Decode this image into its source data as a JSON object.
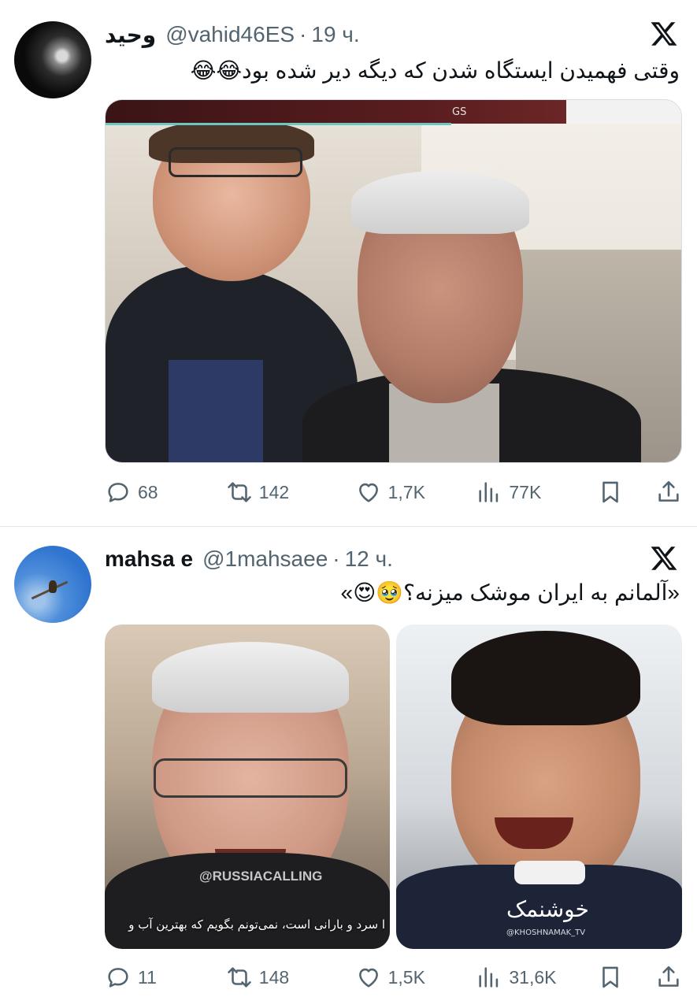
{
  "tweets": [
    {
      "display_name": "وحید",
      "handle": "@vahid46ES",
      "separator": "·",
      "time": "19 ч.",
      "text": "وقتی فهمیدن ایستگاه شدن که دیگه دیر شده بود😂😂",
      "media": [
        {
          "overlay_label": "GS"
        }
      ],
      "stats": {
        "replies": "68",
        "retweets": "142",
        "likes": "1,7K",
        "views": "77K"
      },
      "icons": {
        "reply": "reply-icon",
        "retweet": "retweet-icon",
        "like": "heart-icon",
        "views": "views-icon",
        "bookmark": "bookmark-icon",
        "share": "share-icon",
        "brand": "x-logo-icon"
      }
    },
    {
      "display_name": "mahsa e",
      "handle": "@1mahsaee",
      "separator": "·",
      "time": "12 ч.",
      "text": "«آلمانم به ایران موشک میزنه؟🥹😍»",
      "media": [
        {
          "watermark": "@RUSSIACALLING",
          "subtitle": "ا سرد و بارانی است، نمی‌تونم بگویم که بهترین آب و"
        },
        {
          "logo": "خوشنمک",
          "logo_handle": "@KHOSHNAMAK_TV"
        }
      ],
      "stats": {
        "replies": "11",
        "retweets": "148",
        "likes": "1,5K",
        "views": "31,6K"
      },
      "icons": {
        "reply": "reply-icon",
        "retweet": "retweet-icon",
        "like": "heart-icon",
        "views": "views-icon",
        "bookmark": "bookmark-icon",
        "share": "share-icon",
        "brand": "x-logo-icon"
      }
    }
  ],
  "colors": {
    "text": "#0f1419",
    "secondary": "#536471",
    "divider": "#e6e9ec",
    "background": "#ffffff"
  }
}
